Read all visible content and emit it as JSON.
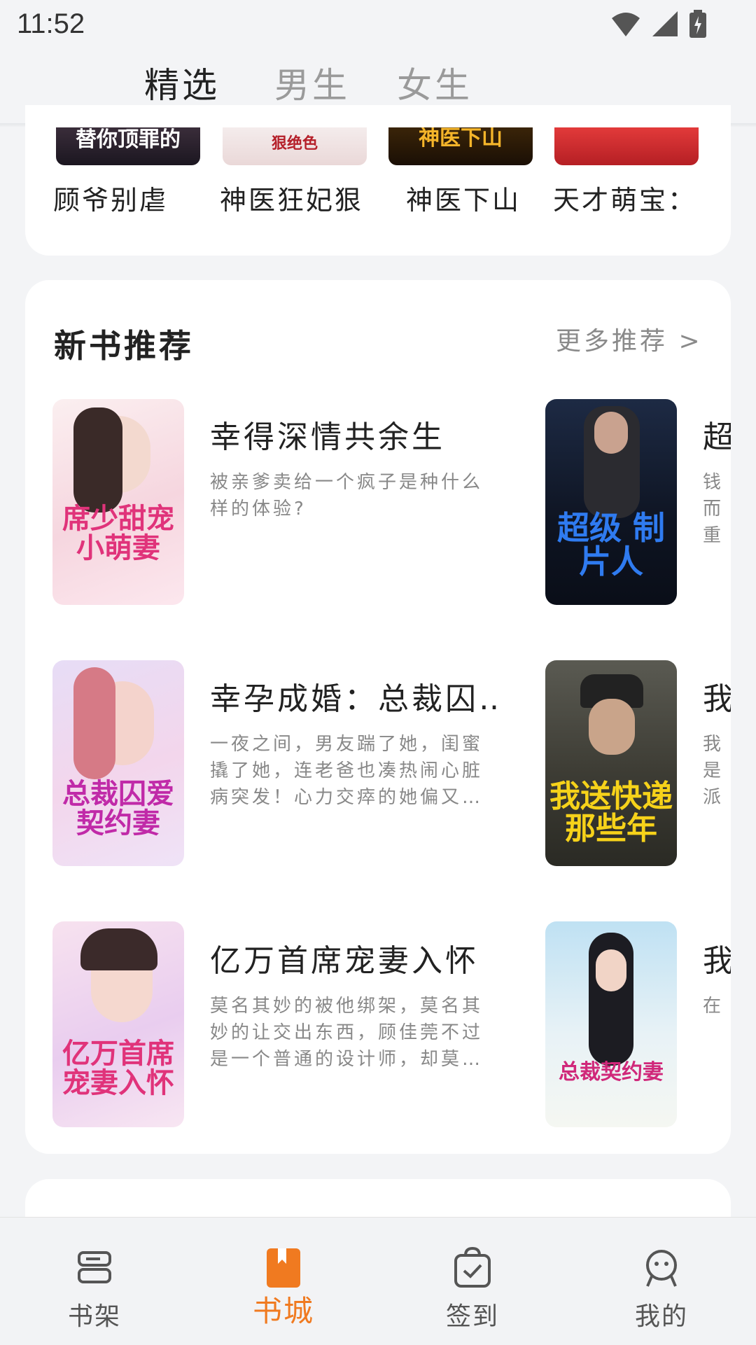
{
  "status_bar": {
    "time": "11:52"
  },
  "top_tabs": [
    {
      "label": "精选",
      "active": true
    },
    {
      "label": "男生",
      "active": false
    },
    {
      "label": "女生",
      "active": false
    }
  ],
  "top_books": [
    {
      "title": "顾爷别虐",
      "cover_text": "替你顶罪的"
    },
    {
      "title": "神医狂妃狠",
      "cover_text": "狠绝色"
    },
    {
      "title": "神医下山",
      "cover_text": "神医下山"
    },
    {
      "title": "天才萌宝：",
      "cover_text": ""
    }
  ],
  "new_books": {
    "title": "新书推荐",
    "more": "更多推荐 >",
    "items": [
      {
        "title": "幸得深情共余生",
        "desc": "被亲爹卖给一个疯子是种什么样的体验?",
        "cover_text": "席少甜宠 小萌妻"
      },
      {
        "title": "超",
        "desc": "钱而 重生 接手",
        "cover_text": "超级 制片人"
      },
      {
        "title": "幸孕成婚：总裁囚…",
        "desc": "一夜之间，男友踹了她，闺蜜撬了她，连老爸也凑热闹心脏病突发！心力交瘁的她偏又…",
        "cover_text": "总裁囚爱 契约妻"
      },
      {
        "title": "我",
        "desc": "我是 派单 的女",
        "cover_text": "我送快递 那些年"
      },
      {
        "title": "亿万首席宠妻入怀",
        "desc": "莫名其妙的被他绑架，莫名其妙的让交出东西，顾佳莞不过是一个普通的设计师，却莫…",
        "cover_text": "亿万首席 宠妻入怀"
      },
      {
        "title": "我",
        "desc": "在占",
        "cover_text": "总裁契约妻"
      }
    ]
  },
  "bottom_nav": [
    {
      "label": "书架",
      "icon": "bookshelf-icon",
      "active": false
    },
    {
      "label": "书城",
      "icon": "bookstore-icon",
      "active": true
    },
    {
      "label": "签到",
      "icon": "checkin-icon",
      "active": false
    },
    {
      "label": "我的",
      "icon": "profile-icon",
      "active": false
    }
  ],
  "colors": {
    "accent": "#f07a20",
    "background": "#f3f4f6"
  }
}
